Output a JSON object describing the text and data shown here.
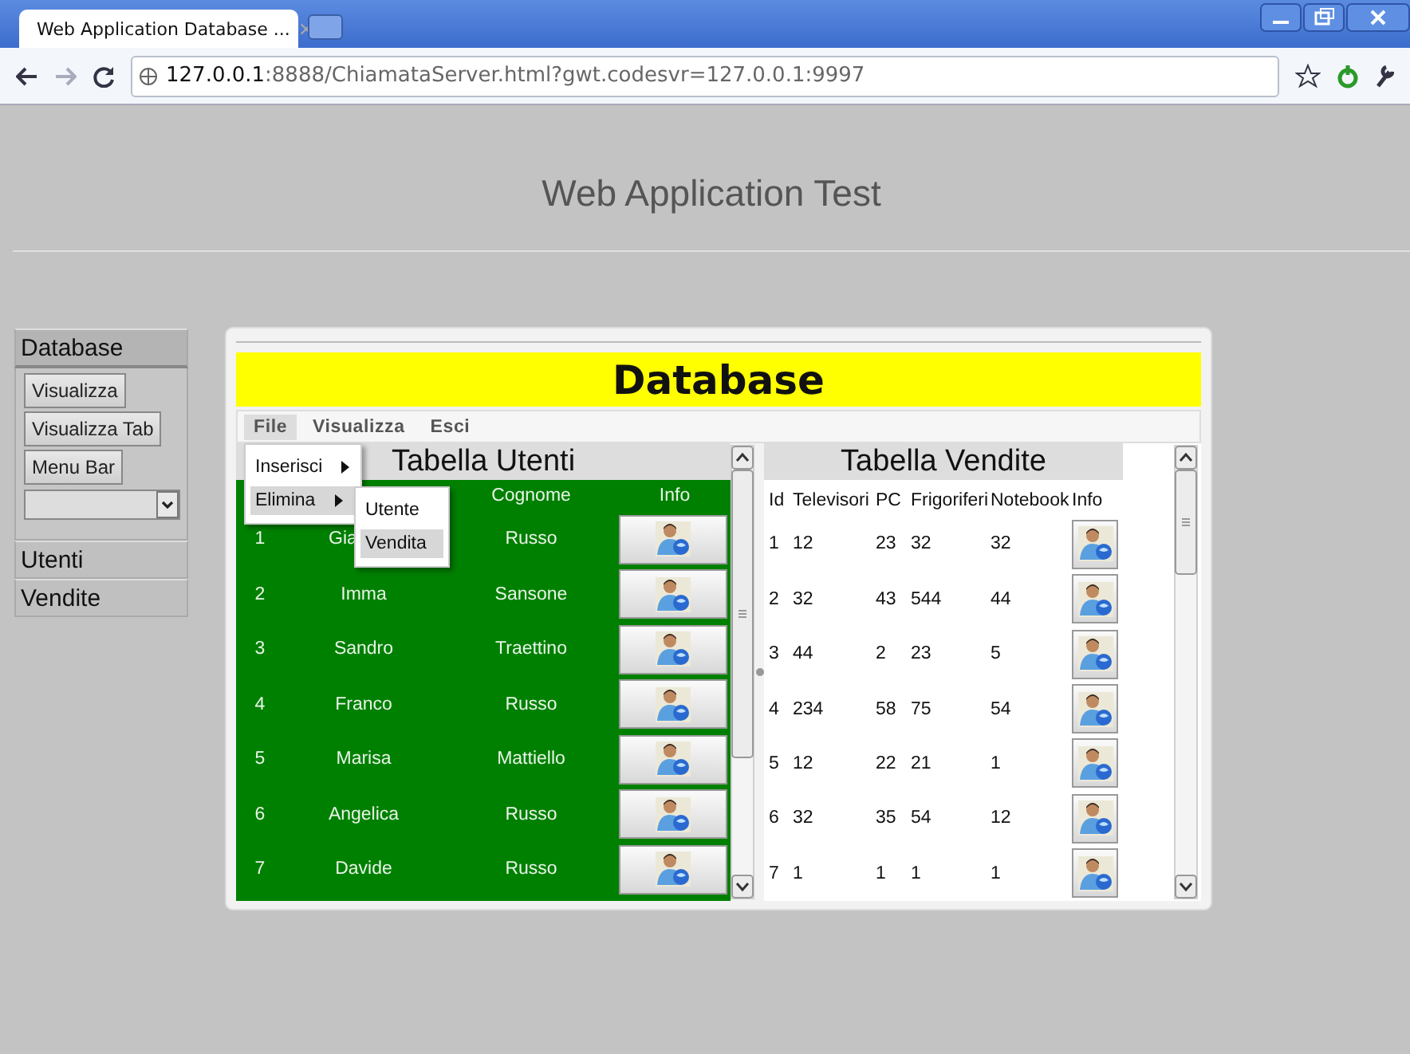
{
  "browser": {
    "tab_title": "Web Application Database ...",
    "tab_close": "×",
    "address_host": "127.0.0.1",
    "address_rest": ":8888/ChiamataServer.html?gwt.codesvr=127.0.0.1:9997"
  },
  "page": {
    "title": "Web Application Test"
  },
  "sidebar": {
    "sections": [
      {
        "label": "Database",
        "expanded": true,
        "buttons": [
          "Visualizza",
          "Visualizza Tab",
          "Menu Bar"
        ]
      },
      {
        "label": "Utenti",
        "expanded": false
      },
      {
        "label": "Vendite",
        "expanded": false
      }
    ]
  },
  "panel": {
    "title": "Database",
    "menu": [
      {
        "label": "File",
        "selected": true
      },
      {
        "label": "Visualizza",
        "selected": false
      },
      {
        "label": "Esci",
        "selected": false
      }
    ],
    "file_menu": [
      {
        "label": "Inserisci",
        "selected": false
      },
      {
        "label": "Elimina",
        "selected": true
      }
    ],
    "submenu": [
      {
        "label": "Utente",
        "selected": false
      },
      {
        "label": "Vendita",
        "selected": true
      }
    ],
    "users": {
      "title": "Tabella Utenti",
      "columns": [
        "Cognome",
        "Info"
      ],
      "rows": [
        {
          "id": "1",
          "name": "Gia",
          "surname": "Russo"
        },
        {
          "id": "2",
          "name": "Imma",
          "surname": "Sansone"
        },
        {
          "id": "3",
          "name": "Sandro",
          "surname": "Traettino"
        },
        {
          "id": "4",
          "name": "Franco",
          "surname": "Russo"
        },
        {
          "id": "5",
          "name": "Marisa",
          "surname": "Mattiello"
        },
        {
          "id": "6",
          "name": "Angelica",
          "surname": "Russo"
        },
        {
          "id": "7",
          "name": "Davide",
          "surname": "Russo"
        }
      ]
    },
    "sales": {
      "title": "Tabella Vendite",
      "columns": [
        "Id",
        "Televisori",
        "PC",
        "Frigoriferi",
        "Notebook",
        "Info"
      ],
      "rows": [
        [
          "1",
          "12",
          "23",
          "32",
          "32"
        ],
        [
          "2",
          "32",
          "43",
          "544",
          "44"
        ],
        [
          "3",
          "44",
          "2",
          "23",
          "5"
        ],
        [
          "4",
          "234",
          "58",
          "75",
          "54"
        ],
        [
          "5",
          "12",
          "22",
          "21",
          "1"
        ],
        [
          "6",
          "32",
          "35",
          "54",
          "12"
        ],
        [
          "7",
          "1",
          "1",
          "1",
          "1"
        ]
      ]
    }
  }
}
